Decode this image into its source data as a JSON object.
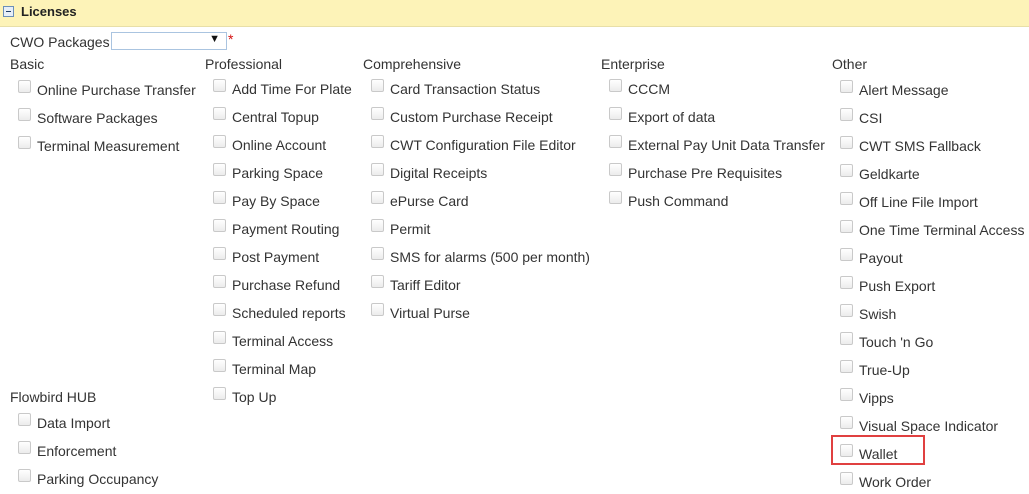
{
  "header": {
    "title": "Licenses"
  },
  "packages": {
    "label": "CWO Packages",
    "selected": "",
    "required_mark": "*"
  },
  "categories": [
    {
      "title": "Basic",
      "items": [
        "Online Purchase Transfer",
        "Software Packages",
        "Terminal Measurement"
      ]
    },
    {
      "title": "Professional",
      "items": [
        "Add Time For Plate",
        "Central Topup",
        "Online Account",
        "Parking Space",
        "Pay By Space",
        "Payment Routing",
        "Post Payment",
        "Purchase Refund",
        "Scheduled reports",
        "Terminal Access",
        "Terminal Map",
        "Top Up"
      ]
    },
    {
      "title": "Comprehensive",
      "items": [
        "Card Transaction Status",
        "Custom Purchase Receipt",
        "CWT Configuration File Editor",
        "Digital Receipts",
        "ePurse Card",
        "Permit",
        "SMS for alarms (500 per month)",
        "Tariff Editor",
        "Virtual Purse"
      ]
    },
    {
      "title": "Enterprise",
      "items": [
        "CCCM",
        "Export of data",
        "External Pay Unit Data Transfer",
        "Purchase Pre Requisites",
        "Push Command"
      ]
    },
    {
      "title": "Other",
      "items": [
        "Alert Message",
        "CSI",
        "CWT SMS Fallback",
        "Geldkarte",
        "Off Line File Import",
        "One Time Terminal Access",
        "Payout",
        "Push Export",
        "Swish",
        "Touch 'n Go",
        "True-Up",
        "Vipps",
        "Visual Space Indicator",
        "Wallet",
        "Work Order"
      ]
    },
    {
      "title": "Flowbird HUB",
      "items": [
        "Data Import",
        "Enforcement",
        "Parking Occupancy"
      ]
    }
  ],
  "highlighted_item": "Wallet"
}
